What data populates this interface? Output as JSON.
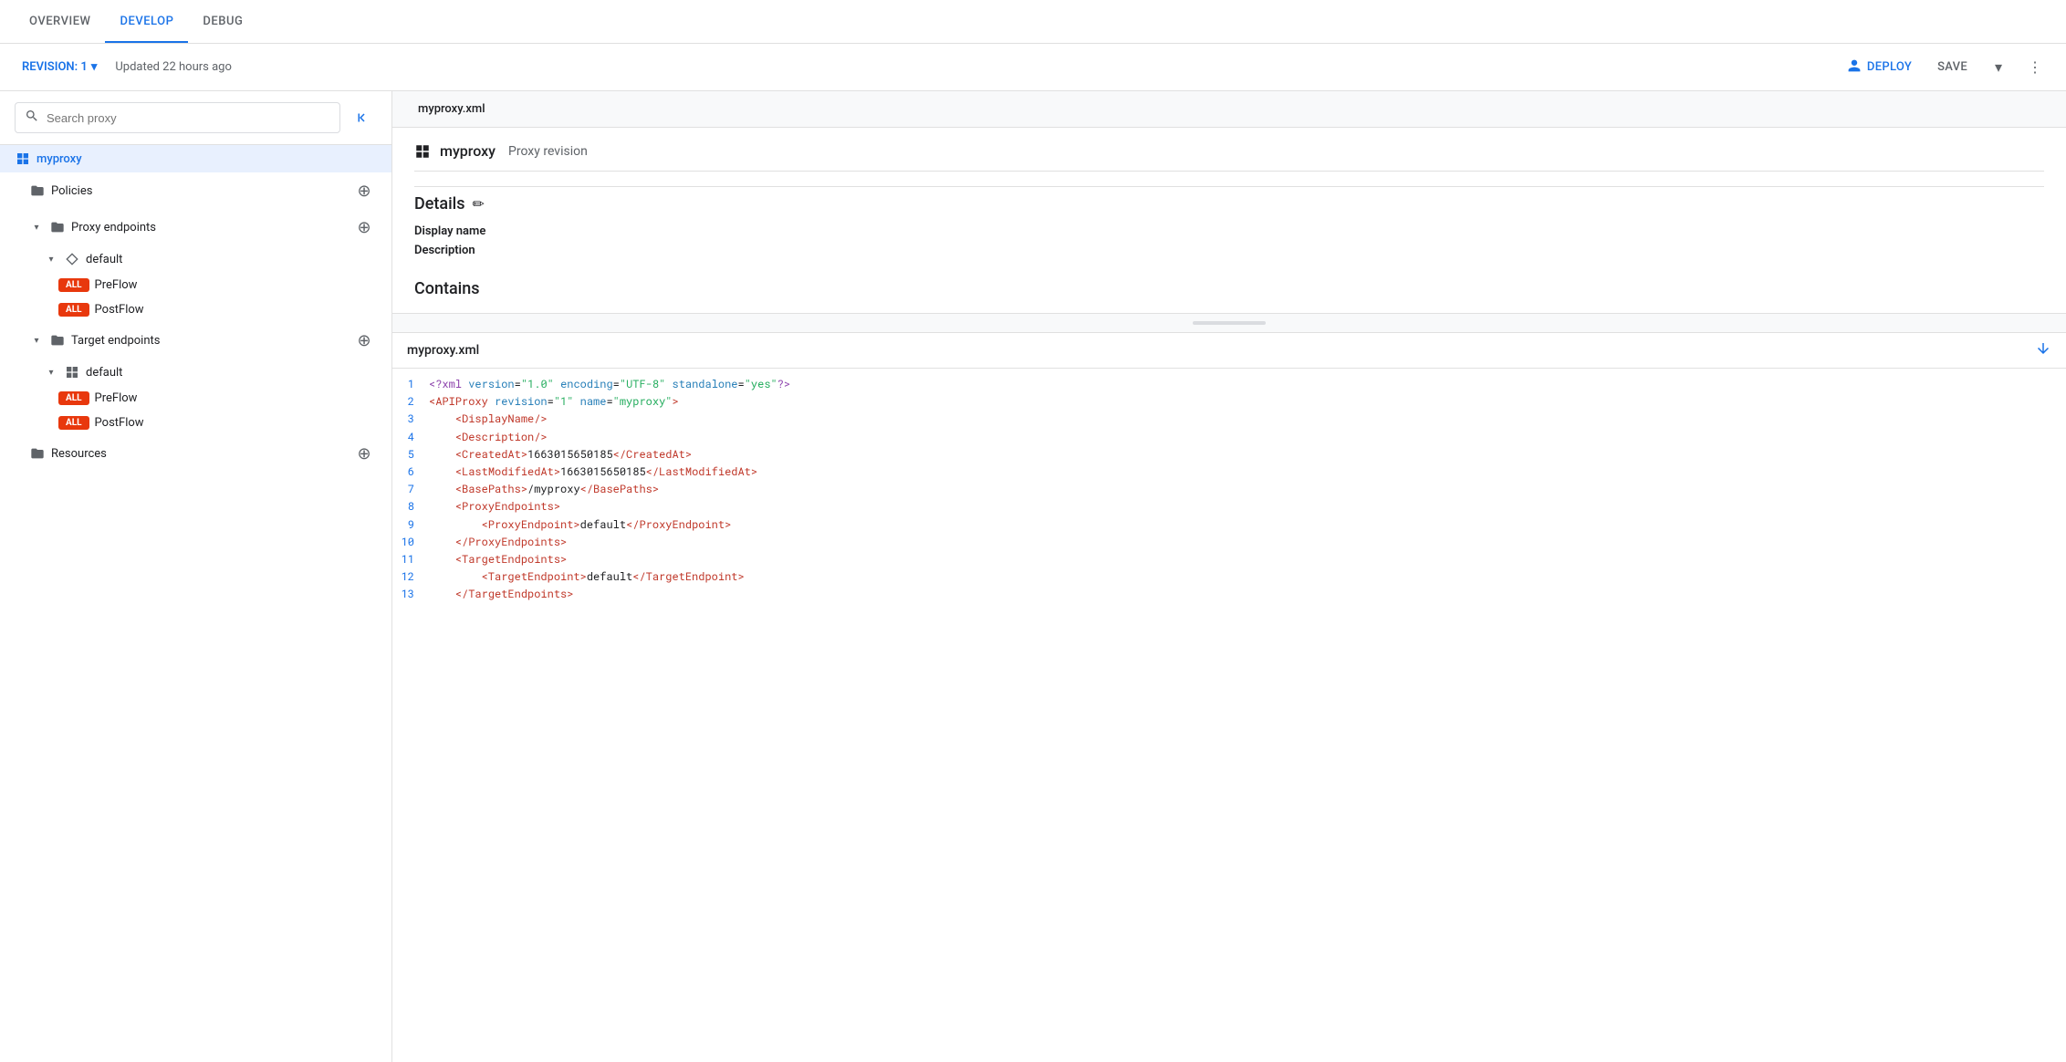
{
  "tabs": {
    "items": [
      {
        "label": "OVERVIEW",
        "active": false
      },
      {
        "label": "DEVELOP",
        "active": true
      },
      {
        "label": "DEBUG",
        "active": false
      }
    ]
  },
  "toolbar": {
    "revision_label": "REVISION: 1",
    "updated_text": "Updated 22 hours ago",
    "deploy_label": "DEPLOY",
    "save_label": "SAVE"
  },
  "sidebar": {
    "search_placeholder": "Search proxy",
    "tree": [
      {
        "id": "myproxy",
        "label": "myproxy",
        "indent": 0,
        "type": "grid",
        "selected": true
      },
      {
        "id": "policies",
        "label": "Policies",
        "indent": 1,
        "type": "folder",
        "has_add": true
      },
      {
        "id": "proxy-endpoints",
        "label": "Proxy endpoints",
        "indent": 1,
        "type": "folder",
        "expanded": true,
        "has_add": true
      },
      {
        "id": "default-proxy",
        "label": "default",
        "indent": 2,
        "type": "diamond",
        "expanded": true
      },
      {
        "id": "preflow-proxy",
        "label": "PreFlow",
        "indent": 3,
        "type": "flow",
        "badge": "ALL"
      },
      {
        "id": "postflow-proxy",
        "label": "PostFlow",
        "indent": 3,
        "type": "flow",
        "badge": "ALL"
      },
      {
        "id": "target-endpoints",
        "label": "Target endpoints",
        "indent": 1,
        "type": "folder",
        "expanded": true,
        "has_add": true
      },
      {
        "id": "default-target",
        "label": "default",
        "indent": 2,
        "type": "grid-small",
        "expanded": true
      },
      {
        "id": "preflow-target",
        "label": "PreFlow",
        "indent": 3,
        "type": "flow",
        "badge": "ALL"
      },
      {
        "id": "postflow-target",
        "label": "PostFlow",
        "indent": 3,
        "type": "flow",
        "badge": "ALL"
      },
      {
        "id": "resources",
        "label": "Resources",
        "indent": 1,
        "type": "folder",
        "has_add": true
      }
    ]
  },
  "file_tab": {
    "name": "myproxy.xml"
  },
  "proxy_detail": {
    "icon_type": "grid",
    "name": "myproxy",
    "subtitle": "Proxy revision",
    "details_title": "Details",
    "display_name_label": "Display name",
    "description_label": "Description",
    "contains_title": "Contains"
  },
  "xml_editor": {
    "filename": "myproxy.xml",
    "lines": [
      {
        "num": 1,
        "content": "<?xml version=\"1.0\" encoding=\"UTF-8\" standalone=\"yes\"?>"
      },
      {
        "num": 2,
        "content": "<APIProxy revision=\"1\" name=\"myproxy\">"
      },
      {
        "num": 3,
        "content": "    <DisplayName/>"
      },
      {
        "num": 4,
        "content": "    <Description/>"
      },
      {
        "num": 5,
        "content": "    <CreatedAt>1663015650185</CreatedAt>"
      },
      {
        "num": 6,
        "content": "    <LastModifiedAt>1663015650185</LastModifiedAt>"
      },
      {
        "num": 7,
        "content": "    <BasePaths>/myproxy</BasePaths>"
      },
      {
        "num": 8,
        "content": "    <ProxyEndpoints>"
      },
      {
        "num": 9,
        "content": "        <ProxyEndpoint>default</ProxyEndpoint>"
      },
      {
        "num": 10,
        "content": "    </ProxyEndpoints>"
      },
      {
        "num": 11,
        "content": "    <TargetEndpoints>"
      },
      {
        "num": 12,
        "content": "        <TargetEndpoint>default</TargetEndpoint>"
      },
      {
        "num": 13,
        "content": "    </TargetEndpoints>"
      }
    ]
  },
  "colors": {
    "accent_blue": "#1a73e8",
    "badge_red": "#e8380d",
    "text_primary": "#202124",
    "text_secondary": "#5f6368",
    "border": "#e0e0e0",
    "selected_bg": "#e8f0fe"
  }
}
